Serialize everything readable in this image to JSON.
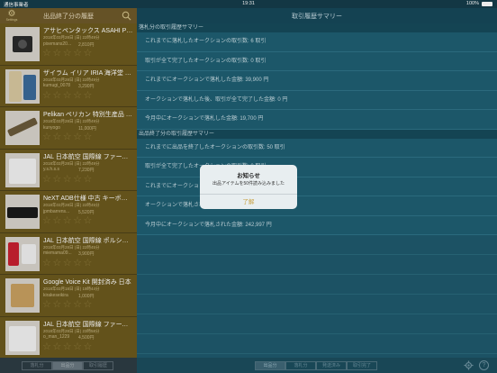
{
  "statusbar": {
    "carrier": "通信事業者",
    "time": "19:31",
    "battery": "100%"
  },
  "left": {
    "title": "出品終了分の履歴",
    "settings_label": "Settings",
    "items": [
      {
        "name": "アサヒペンタックス ASAHI PENTAX",
        "date": "2018年03月28日 (日) 22時49分",
        "seller": "pixemans20...",
        "price": "2,810円"
      },
      {
        "name": "ザイラム イリア IRIA 海洋堂 フィギュア",
        "date": "2018年03月28日 (日) 22時49分",
        "seller": "kumugi_0078",
        "price": "3,290円"
      },
      {
        "name": "Pelikan ペリカン 特別生産品 万年筆",
        "date": "2018年03月28日 (日) 22時49分",
        "seller": "kunyogo",
        "price": "11,000円"
      },
      {
        "name": "JAL 日本航空 国際線 ファーストクラス",
        "date": "2018年03月28日 (日) 22時49分",
        "seller": "y.s.h.s.s",
        "price": "7,230円"
      },
      {
        "name": "NeXT ADB仕様 中古 キーボード",
        "date": "2018年03月28日 (日) 22時45分",
        "seller": "jpmbarrens...",
        "price": "5,520円"
      },
      {
        "name": "JAL 日本航空 国際線 ポルシェ デザイン",
        "date": "2018年03月28日 (日) 22時45分",
        "seller": "miemama09...",
        "price": "3,900円"
      },
      {
        "name": "Google Voice Kit 開封済み 日本",
        "date": "2018年03月18日 (日) 19時44分",
        "seller": "kirakeseikira",
        "price": "1,000円"
      },
      {
        "name": "JAL 日本航空 国際線 ファーストクラス",
        "date": "2018年03月28日 (日) 23時58分",
        "seller": "o_man_1229",
        "price": "4,500円"
      }
    ],
    "tabs": [
      "落札分",
      "出品分",
      "取引履歴"
    ]
  },
  "right": {
    "title": "取引履歴サマリー",
    "sections": [
      {
        "header": "落札分の取引履歴サマリー",
        "rows": [
          "これまでに落札したオークションの取引数: 6 取引",
          "取引が全て完了したオークションの取引数: 0 取引",
          "これまでにオークションで落札した金額: 39,900 円",
          "オークションで落札した後、取引が全て完了した金額: 0 円",
          "今月中にオークションで落札した金額: 19,700 円"
        ]
      },
      {
        "header": "出品終了分の取引履歴サマリー",
        "rows": [
          "これまでに出品を終了したオークションの取引数: 50 取引",
          "取引が全て完了したオークションの取引数: 0 取引",
          "これまでにオークションで落札された金額: 0 円",
          "オークションで落札された後、取引が全て完了した金額: 0 円",
          "今月中にオークションで落札された金額: 242,997 円"
        ]
      }
    ],
    "tabs": [
      "出品分",
      "落札分",
      "発送済み",
      "取引完了"
    ]
  },
  "dialog": {
    "title": "お知らせ",
    "message": "出品アイテムを50件読み込みました",
    "button": "了解"
  },
  "colors": {
    "accent": "#c8a040",
    "left_row": "#6c5a1e",
    "right_bg": "#1f5a6d"
  }
}
